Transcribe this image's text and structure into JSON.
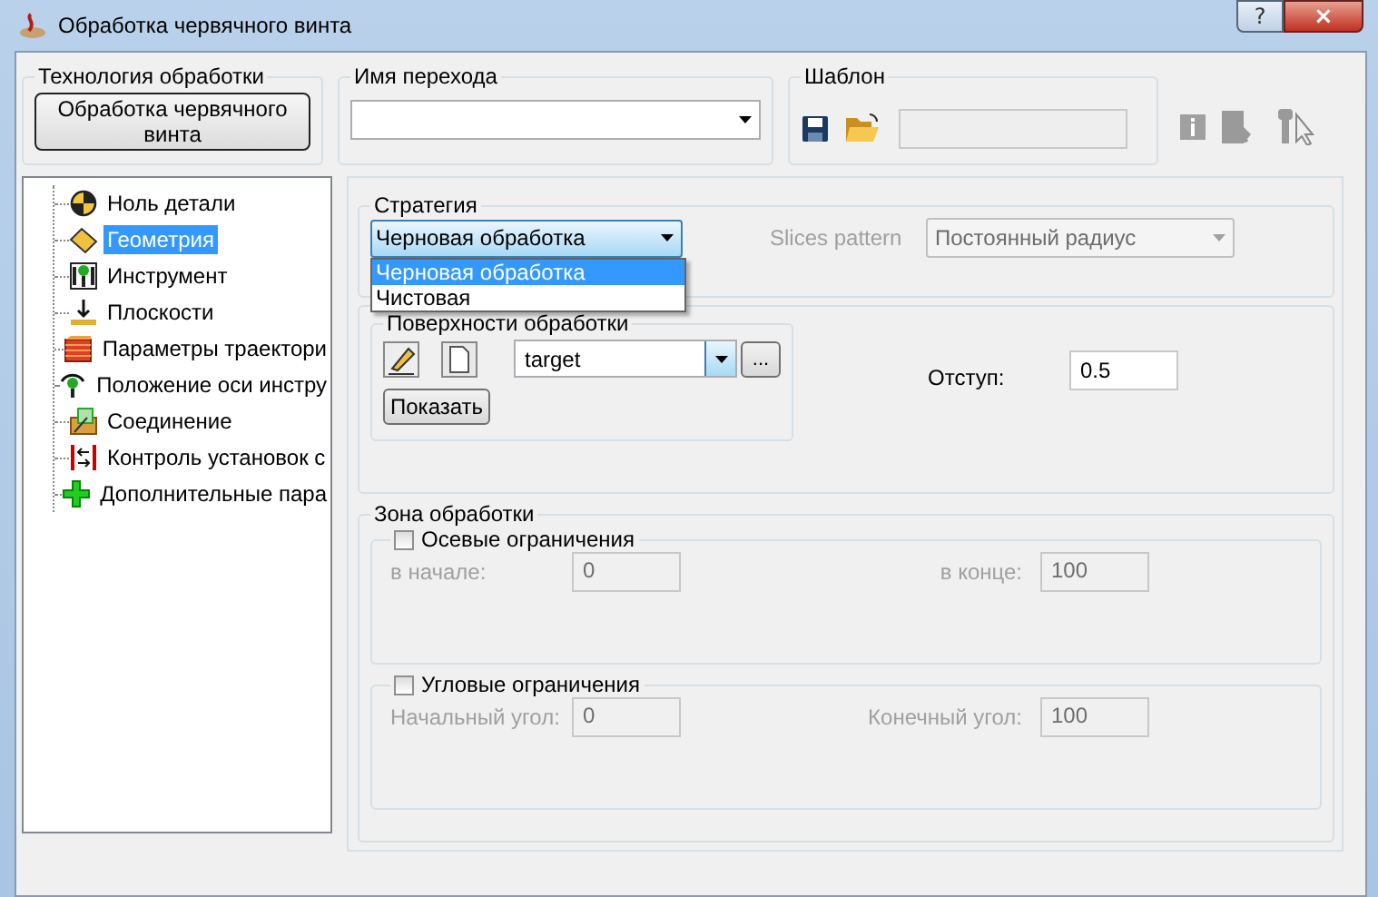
{
  "window": {
    "title": "Обработка червячного винта",
    "help_button": "?",
    "close_button": "×"
  },
  "technology": {
    "label": "Технология обработки",
    "button": "Обработка червячного винта"
  },
  "transition_name": {
    "label": "Имя перехода"
  },
  "template": {
    "label": "Шаблон"
  },
  "tree": {
    "items": [
      {
        "label": "Ноль детали",
        "selected": false
      },
      {
        "label": "Геометрия",
        "selected": true
      },
      {
        "label": "Инструмент",
        "selected": false
      },
      {
        "label": "Плоскости",
        "selected": false
      },
      {
        "label": "Параметры траектори",
        "selected": false
      },
      {
        "label": "Положение оси инстру",
        "selected": false
      },
      {
        "label": "Соединение",
        "selected": false
      },
      {
        "label": "Контроль установок с",
        "selected": false
      },
      {
        "label": "Дополнительные пара",
        "selected": false
      }
    ]
  },
  "strategy": {
    "label": "Стратегия",
    "value": "Черновая обработка",
    "expanded": true,
    "options": [
      {
        "label": "Черновая обработка",
        "selected": true
      },
      {
        "label": "Чистовая",
        "selected": false
      }
    ]
  },
  "slices_pattern": {
    "label": "Slices pattern",
    "value": "Постоянный радиус",
    "disabled": true
  },
  "surfaces": {
    "label": "Поверхности обработки",
    "value": "target",
    "more_button": "...",
    "show_button": "Показать"
  },
  "offset": {
    "label": "Отступ:",
    "value": "0.5"
  },
  "zone": {
    "label": "Зона обработки",
    "groups": [
      {
        "label": "Осевые ограничения",
        "checked": false,
        "fields": [
          {
            "label": "в начале:",
            "value": "0",
            "disabled": true
          },
          {
            "label": "в конце:",
            "value": "100",
            "disabled": true
          }
        ]
      },
      {
        "label": "Угловые ограничения",
        "checked": false,
        "fields": [
          {
            "label": "Начальный угол:",
            "value": "0",
            "disabled": true
          },
          {
            "label": "Конечный угол:",
            "value": "100",
            "disabled": true
          }
        ]
      }
    ]
  }
}
